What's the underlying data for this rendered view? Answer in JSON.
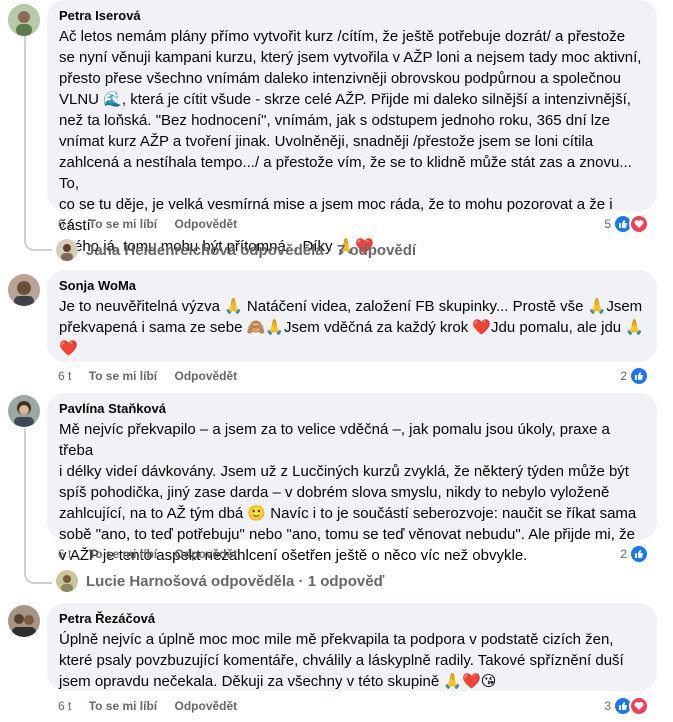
{
  "comments": [
    {
      "author": "Petra Iserová",
      "lines": [
        "Ač letos nemám plány přímo vytvořit kurz /cítím, že ještě potřebuje dozrát/ a přestože",
        "se nyní věnuji kampani kurzu, který jsem vytvořila v AŽP loni a nejsem tady moc aktivní,",
        "přesto přese všechno vnímám daleko intenzivněji obrovskou podpůrnou a společnou",
        "VLNU 🌊, která je cítit všude - skrze celé AŽP. Přijde mi daleko silnější a intenzivnější,",
        "než ta loňská. \"Bez hodnocení\", vnímám, jak s odstupem jednoho roku, 365 dní lze",
        "vnímat kurz AŽP a tvoření jinak. Uvolněněji, snadněji /přestože jsem se loni cítila",
        "zahlcená a nestíhala tempo.../ a přestože vím, že se to klidně může stát zas a znovu... To,",
        "co se tu děje, je velká vesmírná mise a jsem moc ráda, že to mohu pozorovat a že i částí",
        "svého já, tomu mohu být přítomná... Díky 🙏❤️"
      ],
      "time": "6 t",
      "like": "To se mi líbí",
      "reply": "Odpovědět",
      "reaction_count": "5",
      "reactions": [
        "like",
        "love"
      ],
      "replies_summary": "Jana Heidenreichová odpověděla · 7 odpovědí"
    },
    {
      "author": "Sonja WoMa",
      "lines": [
        "Je to neuvěřitelná výzva 🙏 Natáčení videa, založení FB skupinky... Prostě vše 🙏Jsem",
        "překvapená i sama ze sebe 🙈🙏Jsem vděčná za každý krok ❤️Jdu pomalu, ale jdu 🙏",
        "❤️"
      ],
      "time": "6 t",
      "like": "To se mi líbí",
      "reply": "Odpovědět",
      "reaction_count": "2",
      "reactions": [
        "like"
      ]
    },
    {
      "author": "Pavlína Staňková",
      "lines": [
        "Mě nejvíc překvapilo – a jsem za to velice vděčná –, jak pomalu jsou úkoly, praxe a třeba",
        "i délky videí dávkovány. Jsem už z Lucčiných kurzů zvyklá, že některý týden může být",
        "spíš pohodička, jiný zase darda – v dobrém slova smyslu, nikdy to nebylo vyloženě",
        "zahlcující, na to AŽ tým dbá 🙂 Navíc i to je součástí seberozvoje: naučit se říkat sama",
        "sobě \"ano, to teď potřebuju\" nebo \"ano, tomu se teď věnovat nebudu\". Ale přijde mi, že",
        "v AŽP je tento aspekt nezahlcení ošetřen ještě o něco víc než obvykle."
      ],
      "time": "6 t",
      "like": "To se mi líbí",
      "reply": "Odpovědět",
      "reaction_count": "2",
      "reactions": [
        "like"
      ],
      "replies_summary": "Lucie Harnošová odpověděla · 1 odpověď"
    },
    {
      "author": "Petra Řezáčová",
      "lines": [
        "Úplně nejvíc a úplně moc moc mile mě překvapila ta podpora v podstatě cizích žen,",
        "které psaly povzbuzující komentáře, chválily a láskyplně radily. Takové spříznění duší",
        "jsem opravdu nečekala. Děkuji za všechny v této skupině 🙏❤️😘"
      ],
      "time": "6 t",
      "like": "To se mi líbí",
      "reply": "Odpovědět",
      "reaction_count": "3",
      "reactions": [
        "like",
        "love"
      ]
    }
  ],
  "colors": {
    "bubble": "#f0f2f5",
    "meta": "#65676b",
    "like": "#1877f2",
    "love": "#f33e58"
  }
}
